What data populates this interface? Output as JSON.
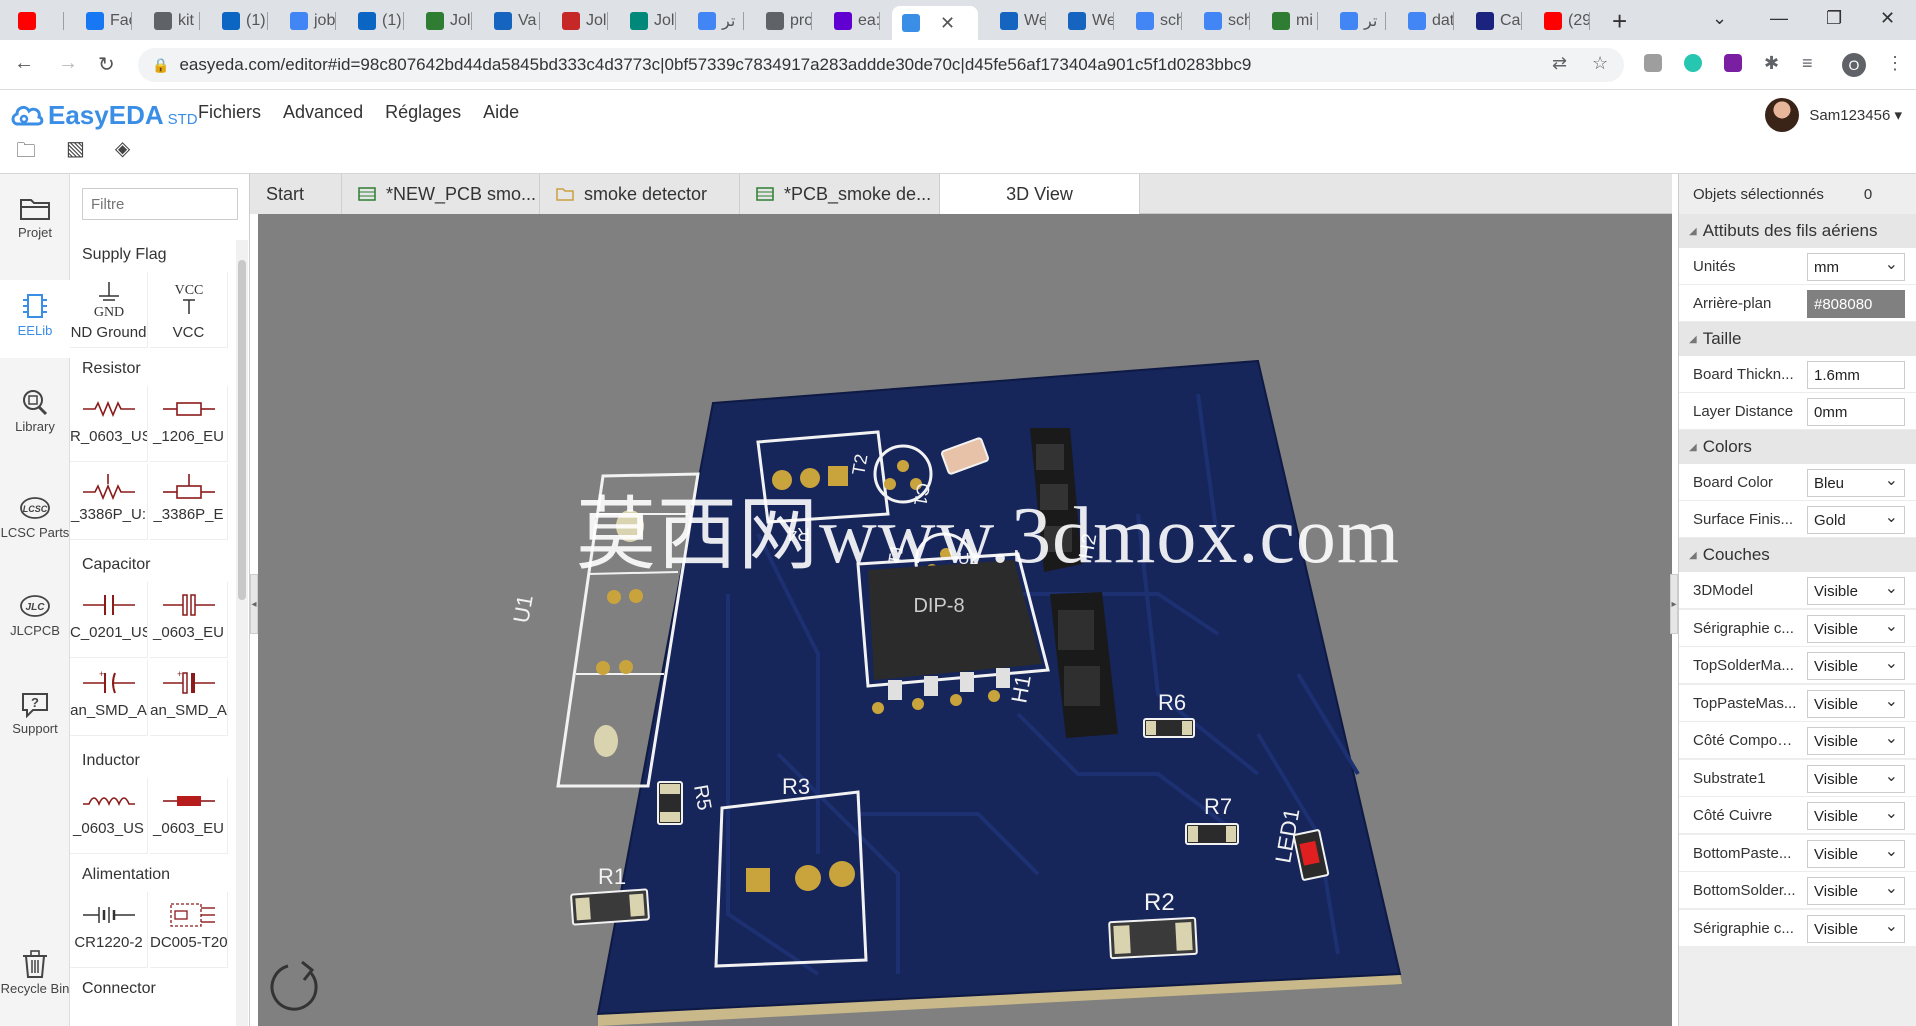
{
  "browser": {
    "tabs": [
      {
        "label": "",
        "favicon": "youtube-favicon",
        "color": "#ff0000"
      },
      {
        "label": "Fac",
        "favicon": "facebook-favicon",
        "color": "#1877f2"
      },
      {
        "label": "kit",
        "favicon": "globe-favicon",
        "color": "#5f6368"
      },
      {
        "label": "(1)",
        "favicon": "linkedin-favicon",
        "color": "#0a66c2"
      },
      {
        "label": "job",
        "favicon": "google-favicon",
        "color": "#4285f4"
      },
      {
        "label": "(1)",
        "favicon": "linkedin-favicon",
        "color": "#0a66c2"
      },
      {
        "label": "Jol",
        "favicon": "k-favicon",
        "color": "#2e7d32"
      },
      {
        "label": "Va",
        "favicon": "un-favicon",
        "color": "#1565c0"
      },
      {
        "label": "Jol",
        "favicon": "w-favicon",
        "color": "#c62828"
      },
      {
        "label": "Jol",
        "favicon": "job-favicon",
        "color": "#00897b"
      },
      {
        "label": "تر",
        "favicon": "translate-favicon",
        "color": "#4285f4"
      },
      {
        "label": "pro",
        "favicon": "globe-favicon",
        "color": "#5f6368"
      },
      {
        "label": "ea:",
        "favicon": "yahoo-favicon",
        "color": "#6001d2"
      },
      {
        "label": "",
        "favicon": "easyeda-favicon",
        "color": "#3a8ee6",
        "active": true
      },
      {
        "label": "We",
        "favicon": "lc-favicon",
        "color": "#1565c0"
      },
      {
        "label": "We",
        "favicon": "lc-favicon",
        "color": "#1565c0"
      },
      {
        "label": "sch",
        "favicon": "google-favicon",
        "color": "#4285f4"
      },
      {
        "label": "sch",
        "favicon": "google-favicon",
        "color": "#4285f4"
      },
      {
        "label": "mi",
        "favicon": "download-favicon",
        "color": "#2e7d32"
      },
      {
        "label": "تر",
        "favicon": "translate-favicon",
        "color": "#4285f4"
      },
      {
        "label": "dat",
        "favicon": "google-favicon",
        "color": "#4285f4"
      },
      {
        "label": "Ca",
        "favicon": "ca-favicon",
        "color": "#1a237e"
      },
      {
        "label": "(29",
        "favicon": "youtube-favicon",
        "color": "#ff0000"
      }
    ],
    "url": "easyeda.com/editor#id=98c807642bd44da5845bd333c4d3773c|0bf57339c7834917a283addde30de70c|d45fe56af173404a901c5f1d0283bbc9",
    "profile_initial": "O"
  },
  "app": {
    "logo_text": "EasyEDA",
    "logo_suffix": "STD",
    "menu": [
      "Fichiers",
      "Advanced",
      "Réglages",
      "Aide"
    ],
    "user_name": "Sam123456 ▾",
    "brand_color": "#3a8ee6"
  },
  "left_rail": [
    {
      "label": "Projet",
      "icon": "folder-icon"
    },
    {
      "label": "EELib",
      "icon": "chip-icon",
      "active": true
    },
    {
      "label": "Library",
      "icon": "library-search-icon"
    },
    {
      "label": "LCSC Parts",
      "icon": "lcsc-icon"
    },
    {
      "label": "JLCPCB",
      "icon": "jlcpcb-icon"
    },
    {
      "label": "Support",
      "icon": "support-icon"
    },
    {
      "label": "Recycle Bin",
      "icon": "recycle-bin-icon"
    }
  ],
  "library": {
    "filter_placeholder": "Filtre",
    "sections": {
      "supply": "Supply Flag",
      "resistor": "Resistor",
      "capacitor": "Capacitor",
      "inductor": "Inductor",
      "alimentation": "Alimentation",
      "connector": "Connector"
    },
    "items": {
      "gnd": "ND Ground",
      "vcc": "VCC",
      "gnd_symbol_text": "GND",
      "vcc_symbol_text": "VCC",
      "r0603": "R_0603_US",
      "r1206": "_1206_EU",
      "pot1": "_3386P_U:",
      "pot2": "_3386P_E",
      "c0201": "C_0201_US",
      "c0603": "_0603_EU",
      "csmd1": "an_SMD_A",
      "csmd2": "an_SMD_A",
      "l0603us": "_0603_US",
      "l0603eu": "_0603_EU",
      "bat": "CR1220-2",
      "dc": "DC005-T20"
    }
  },
  "doc_tabs": [
    {
      "label": "Start",
      "icon": ""
    },
    {
      "label": "*NEW_PCB smo...",
      "icon": "pcb-tab-icon"
    },
    {
      "label": "smoke detector",
      "icon": "folder-tab-icon"
    },
    {
      "label": "*PCB_smoke de...",
      "icon": "pcb-tab-icon"
    },
    {
      "label": "3D View",
      "icon": "",
      "active": true
    }
  ],
  "canvas": {
    "background": "#808080",
    "watermark": "莫西网www.3dmox.com",
    "board_color": "#16255a",
    "silk": {
      "u1": "U1",
      "ic": "DIP-8",
      "ic_ref": "U2",
      "r4": "R4",
      "t2": "T2",
      "t1": "T1",
      "c1": "C1",
      "h2": "H2",
      "h1": "H1",
      "r6": "R6",
      "r5": "R5",
      "r3": "R3",
      "r7": "R7",
      "led1": "LED1",
      "r1": "R1",
      "r2": "R2"
    }
  },
  "properties": {
    "selected_label": "Objets sélectionnés",
    "selected_count": "0",
    "sections": {
      "wires": "Attibuts des fils aériens",
      "size": "Taille",
      "colors": "Colors",
      "layers": "Couches"
    },
    "units": {
      "label": "Unités",
      "value": "mm"
    },
    "background": {
      "label": "Arrière-plan",
      "value": "#808080"
    },
    "board_thickness": {
      "label": "Board Thickn...",
      "value": "1.6mm"
    },
    "layer_distance": {
      "label": "Layer Distance",
      "value": "0mm"
    },
    "board_color": {
      "label": "Board Color",
      "value": "Bleu"
    },
    "surface_finish": {
      "label": "Surface Finis...",
      "value": "Gold"
    },
    "layers": [
      {
        "label": "3DModel",
        "value": "Visible"
      },
      {
        "label": "Sérigraphie c...",
        "value": "Visible"
      },
      {
        "label": "TopSolderMa...",
        "value": "Visible"
      },
      {
        "label": "TopPasteMas...",
        "value": "Visible"
      },
      {
        "label": "Côté Compos...",
        "value": "Visible"
      },
      {
        "label": "Substrate1",
        "value": "Visible"
      },
      {
        "label": "Côté Cuivre",
        "value": "Visible"
      },
      {
        "label": "BottomPaste...",
        "value": "Visible"
      },
      {
        "label": "BottomSolder...",
        "value": "Visible"
      },
      {
        "label": "Sérigraphie c...",
        "value": "Visible"
      }
    ]
  }
}
